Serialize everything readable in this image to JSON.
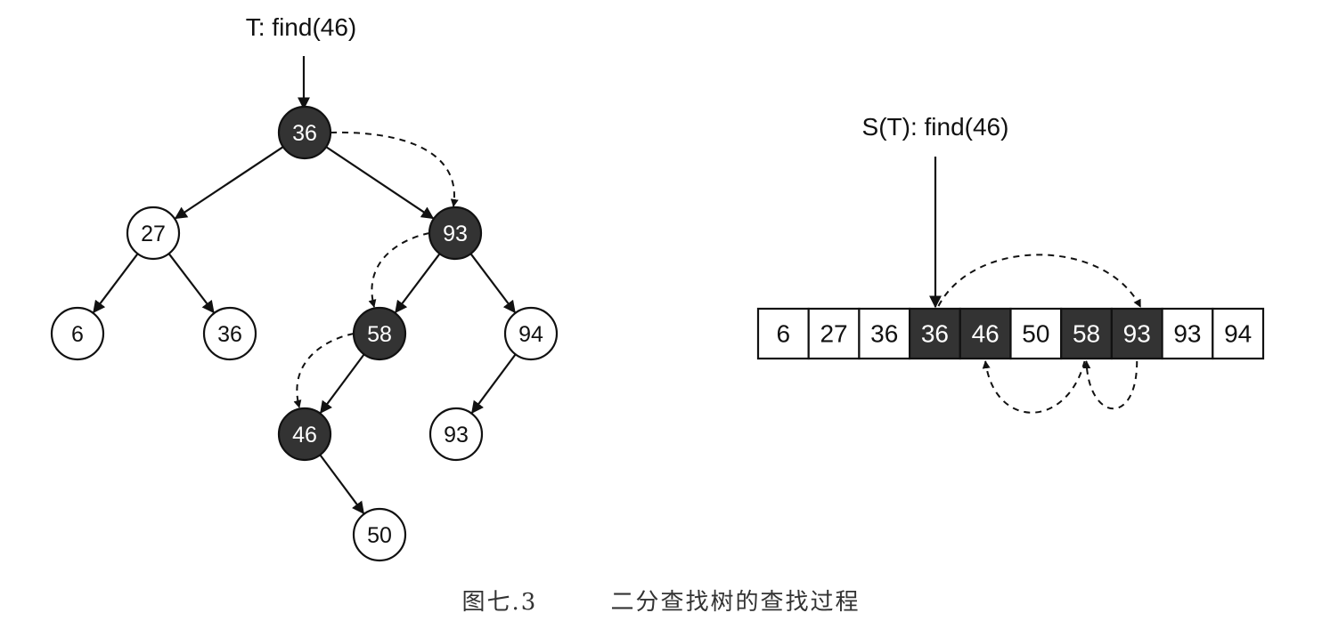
{
  "tree": {
    "label": "T: find(46)",
    "nodes": [
      {
        "id": "n36",
        "value": "36",
        "highlighted": true
      },
      {
        "id": "n27",
        "value": "27",
        "highlighted": false
      },
      {
        "id": "n93",
        "value": "93",
        "highlighted": true
      },
      {
        "id": "n6",
        "value": "6",
        "highlighted": false
      },
      {
        "id": "n36b",
        "value": "36",
        "highlighted": false
      },
      {
        "id": "n58",
        "value": "58",
        "highlighted": true
      },
      {
        "id": "n94",
        "value": "94",
        "highlighted": false
      },
      {
        "id": "n46",
        "value": "46",
        "highlighted": true
      },
      {
        "id": "n93b",
        "value": "93",
        "highlighted": false
      },
      {
        "id": "n50",
        "value": "50",
        "highlighted": false
      }
    ],
    "edges": [
      [
        "n36",
        "n27"
      ],
      [
        "n36",
        "n93"
      ],
      [
        "n27",
        "n6"
      ],
      [
        "n27",
        "n36b"
      ],
      [
        "n93",
        "n58"
      ],
      [
        "n93",
        "n94"
      ],
      [
        "n58",
        "n46"
      ],
      [
        "n94",
        "n93b"
      ],
      [
        "n46",
        "n50"
      ]
    ],
    "search_path": [
      "n36",
      "n93",
      "n58",
      "n46"
    ]
  },
  "sequence": {
    "label": "S(T): find(46)",
    "cells": [
      {
        "value": "6",
        "highlighted": false
      },
      {
        "value": "27",
        "highlighted": false
      },
      {
        "value": "36",
        "highlighted": false
      },
      {
        "value": "36",
        "highlighted": true
      },
      {
        "value": "46",
        "highlighted": true
      },
      {
        "value": "50",
        "highlighted": false
      },
      {
        "value": "58",
        "highlighted": true
      },
      {
        "value": "93",
        "highlighted": true
      },
      {
        "value": "93",
        "highlighted": false
      },
      {
        "value": "94",
        "highlighted": false
      }
    ],
    "search_steps": [
      [
        3,
        7
      ],
      [
        7,
        6
      ],
      [
        6,
        4
      ]
    ]
  },
  "caption": {
    "figure_number": "图七.3",
    "title": "二分查找树的查找过程"
  },
  "colors": {
    "highlight_fill": "#333333",
    "highlight_text": "#ffffff",
    "normal_fill": "#ffffff",
    "normal_text": "#111111",
    "stroke": "#111111"
  }
}
